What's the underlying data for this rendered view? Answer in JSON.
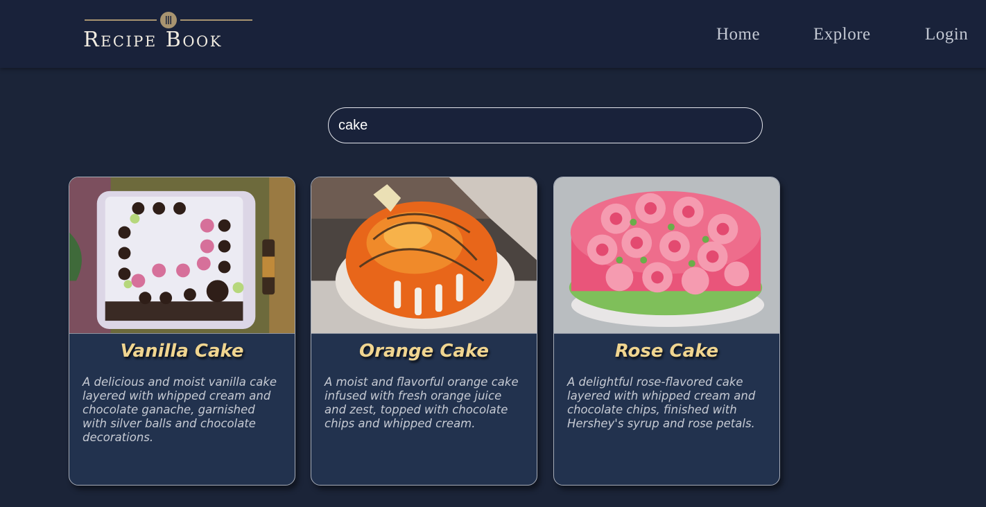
{
  "header": {
    "logo_text": "Recipe Book",
    "nav": {
      "home": "Home",
      "explore": "Explore",
      "login": "Login"
    }
  },
  "search": {
    "value": "cake"
  },
  "results": [
    {
      "title": "Vanilla Cake",
      "description": "A delicious and moist vanilla cake layered with whipped cream and chocolate ganache, garnished with silver balls and chocolate decorations.",
      "image": "vanilla-cake-photo"
    },
    {
      "title": "Orange Cake",
      "description": "A moist and flavorful orange cake infused with fresh orange juice and zest, topped with chocolate chips and whipped cream.",
      "image": "orange-cake-photo"
    },
    {
      "title": "Rose Cake",
      "description": "A delightful rose-flavored cake layered with whipped cream and chocolate chips, finished with Hershey's syrup and rose petals.",
      "image": "rose-cake-photo"
    }
  ],
  "colors": {
    "background": "#1b2438",
    "card": "#22324e",
    "title": "#f0d590",
    "accent": "#a89470"
  }
}
